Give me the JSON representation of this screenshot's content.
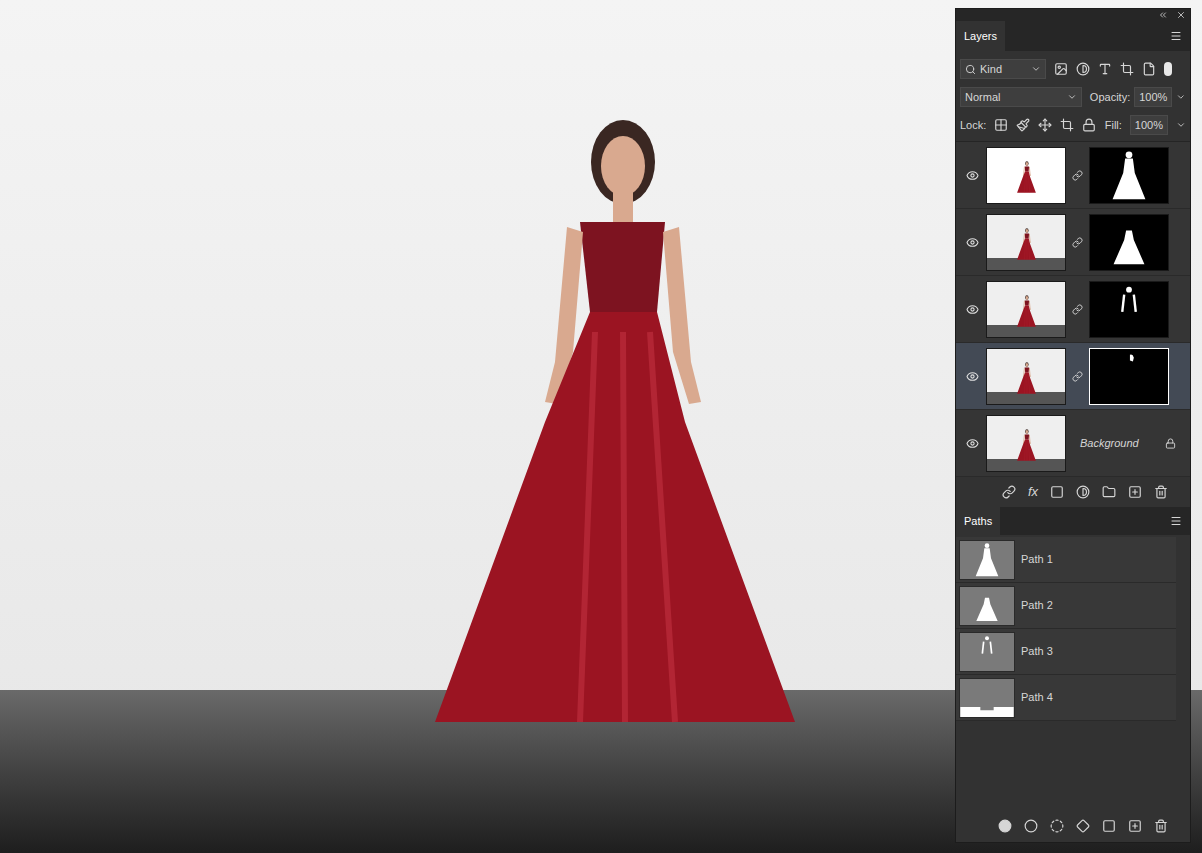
{
  "layers_panel": {
    "tab": "Layers",
    "filter": {
      "label": "Kind"
    },
    "blend_mode": "Normal",
    "opacity": {
      "label": "Opacity:",
      "value": "100%"
    },
    "lock": {
      "label": "Lock:"
    },
    "fill": {
      "label": "Fill:",
      "value": "100%"
    },
    "layers": [
      {
        "kind": "masked",
        "name": "",
        "visible": true,
        "selected": false,
        "mask": "full-figure",
        "thumb": "white"
      },
      {
        "kind": "masked",
        "name": "",
        "visible": true,
        "selected": false,
        "mask": "dress",
        "thumb": "studio"
      },
      {
        "kind": "masked",
        "name": "",
        "visible": true,
        "selected": false,
        "mask": "arms",
        "thumb": "studio"
      },
      {
        "kind": "masked",
        "name": "",
        "visible": true,
        "selected": true,
        "mask": "small",
        "thumb": "studio"
      },
      {
        "kind": "background",
        "name": "Background",
        "visible": true,
        "selected": false,
        "locked": true,
        "thumb": "studio"
      }
    ],
    "toolbar": {
      "fx": "fx"
    }
  },
  "paths_panel": {
    "tab": "Paths",
    "paths": [
      {
        "name": "Path 1",
        "shape": "full-figure"
      },
      {
        "name": "Path 2",
        "shape": "dress"
      },
      {
        "name": "Path 3",
        "shape": "arms"
      },
      {
        "name": "Path 4",
        "shape": "floor"
      }
    ]
  }
}
